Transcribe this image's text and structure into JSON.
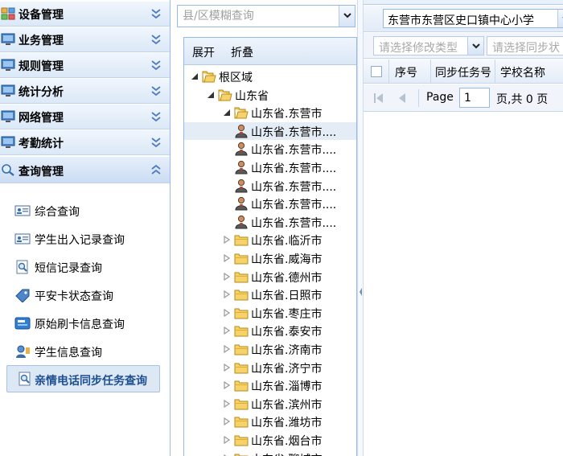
{
  "sidebar": {
    "headers": [
      {
        "label": "设备管理"
      },
      {
        "label": "业务管理"
      },
      {
        "label": "规则管理"
      },
      {
        "label": "统计分析"
      },
      {
        "label": "网络管理"
      },
      {
        "label": "考勤统计"
      },
      {
        "label": "查询管理"
      }
    ],
    "items": [
      {
        "label": "综合查询"
      },
      {
        "label": "学生出入记录查询"
      },
      {
        "label": "短信记录查询"
      },
      {
        "label": "平安卡状态查询"
      },
      {
        "label": "原始刷卡信息查询"
      },
      {
        "label": "学生信息查询"
      },
      {
        "label": "亲情电话同步任务查询"
      }
    ]
  },
  "tree": {
    "search_placeholder": "县/区模糊查询",
    "expand_label": "展开",
    "collapse_label": "折叠",
    "root": "根区域",
    "province": "山东省",
    "city_open": "山东省.东营市",
    "schools": [
      "山东省.东营市....",
      "山东省.东营市....",
      "山东省.东营市....",
      "山东省.东营市....",
      "山东省.东营市....",
      "山东省.东营市...."
    ],
    "cities": [
      "山东省.临沂市",
      "山东省.威海市",
      "山东省.德州市",
      "山东省.日照市",
      "山东省.枣庄市",
      "山东省.泰安市",
      "山东省.济南市",
      "山东省.济宁市",
      "山东省.淄博市",
      "山东省.滨州市",
      "山东省.潍坊市",
      "山东省.烟台市",
      "山东省.聊城市"
    ]
  },
  "grid": {
    "school_value": "东营市东营区史口镇中心小学",
    "filter_type_placeholder": "请选择修改类型",
    "filter_sync_placeholder": "请选择同步状",
    "columns": [
      "序号",
      "同步任务号",
      "学校名称"
    ],
    "pager": {
      "page_label": "Page",
      "page_value": "1",
      "total_label": "页,共 0 页"
    }
  }
}
